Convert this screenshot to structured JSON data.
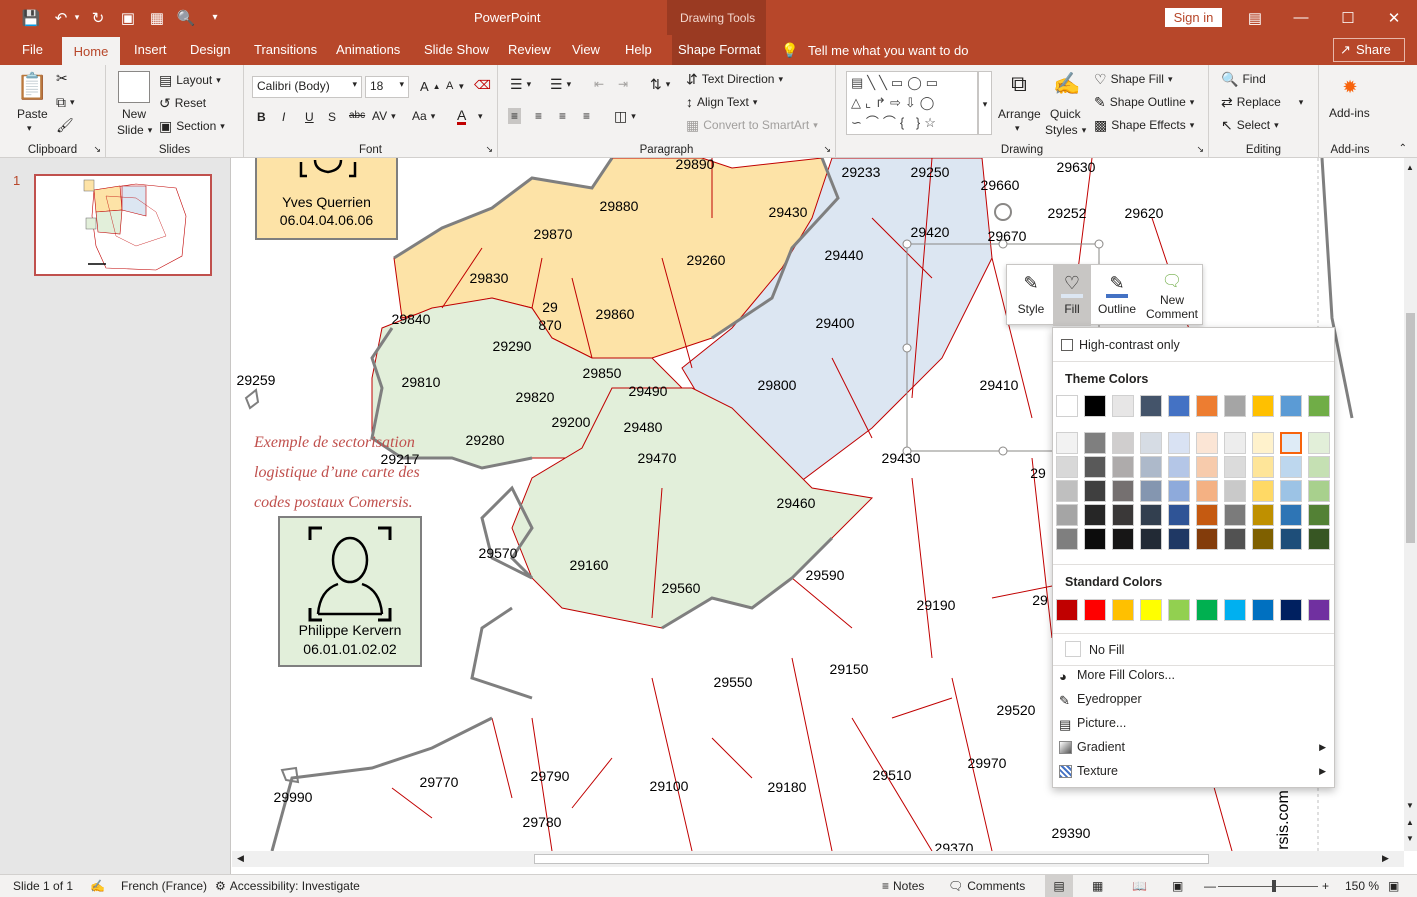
{
  "app": {
    "title": "PowerPoint",
    "context_title": "Drawing Tools",
    "sign_in": "Sign in",
    "share": "Share"
  },
  "tabs": [
    "File",
    "Home",
    "Insert",
    "Design",
    "Transitions",
    "Animations",
    "Slide Show",
    "Review",
    "View",
    "Help",
    "Shape Format"
  ],
  "tell_me": "Tell me what you want to do",
  "ribbon": {
    "clipboard": {
      "label": "Clipboard",
      "paste": "Paste"
    },
    "slides": {
      "label": "Slides",
      "new_slide_1": "New",
      "new_slide_2": "Slide",
      "layout": "Layout",
      "reset": "Reset",
      "section": "Section"
    },
    "font": {
      "label": "Font",
      "font_name": "Calibri (Body)",
      "font_size": "18",
      "bold": "B",
      "italic": "I",
      "underline": "U",
      "shadow": "S",
      "strike": "abc",
      "spacing": "AV",
      "case": "Aa",
      "color": "A",
      "grow": "A",
      "shrink": "A"
    },
    "paragraph": {
      "label": "Paragraph",
      "text_direction": "Text Direction",
      "align_text": "Align Text",
      "convert_smartart": "Convert to SmartArt"
    },
    "drawing": {
      "label": "Drawing",
      "arrange": "Arrange",
      "quick_styles_1": "Quick",
      "quick_styles_2": "Styles",
      "shape_fill": "Shape Fill",
      "shape_outline": "Shape Outline",
      "shape_effects": "Shape Effects"
    },
    "editing": {
      "label": "Editing",
      "find": "Find",
      "replace": "Replace",
      "select": "Select"
    },
    "addins": {
      "label": "Add-ins",
      "addins": "Add-ins"
    }
  },
  "slide_panel": {
    "number": "1",
    "caption_lines": [
      "Exemple de sectorisation",
      "logistique d’une carte des",
      "codes postaux Comersis."
    ]
  },
  "contacts": [
    {
      "name": "Yves Querrien",
      "phone": "06.04.04.06.06",
      "color": "#fde3a7"
    },
    {
      "name": "Philippe Kervern",
      "phone": "06.01.01.02.02",
      "color": "#e2efda"
    }
  ],
  "map_labels": [
    "29890",
    "29233",
    "29250",
    "29630",
    "29880",
    "29430",
    "29660",
    "29252",
    "29620",
    "29870",
    "29420",
    "29670",
    "29830",
    "29260",
    "29440",
    "29860",
    "29840",
    "29",
    "870",
    "29400",
    "29290",
    "29410",
    "29810",
    "29800",
    "29259",
    "29850",
    "29490",
    "29820",
    "29200",
    "29480",
    "29217",
    "29280",
    "29470",
    "29430",
    "29460",
    "29570",
    "29160",
    "29590",
    "29190",
    "29560",
    "29150",
    "29550",
    "29520",
    "29970",
    "29770",
    "29790",
    "29100",
    "29180",
    "29510",
    "29780",
    "29390",
    "29990",
    "29370",
    "29",
    "29",
    "rsis.com"
  ],
  "mini_toolbar": {
    "style": "Style",
    "fill": "Fill",
    "outline": "Outline",
    "new_comment_1": "New",
    "new_comment_2": "Comment"
  },
  "fill_menu": {
    "high_contrast": "High-contrast only",
    "theme_header": "Theme Colors",
    "standard_header": "Standard Colors",
    "no_fill": "No Fill",
    "more_colors": "More Fill Colors...",
    "eyedropper": "Eyedropper",
    "picture": "Picture...",
    "gradient": "Gradient",
    "texture": "Texture",
    "theme_top": [
      "#ffffff",
      "#000000",
      "#e7e6e6",
      "#44546a",
      "#4472c4",
      "#ed7d31",
      "#a5a5a5",
      "#ffc000",
      "#5b9bd5",
      "#70ad47"
    ],
    "theme_shades": [
      [
        "#f2f2f2",
        "#7f7f7f",
        "#d0cece",
        "#d6dce4",
        "#d9e2f3",
        "#fbe5d5",
        "#ededed",
        "#fff2cc",
        "#deebf6",
        "#e2efd9"
      ],
      [
        "#d8d8d8",
        "#595959",
        "#aeabab",
        "#adb9ca",
        "#b4c6e7",
        "#f7cbac",
        "#dbdbdb",
        "#fee599",
        "#bdd7ee",
        "#c5e0b3"
      ],
      [
        "#bfbfbf",
        "#3f3f3f",
        "#757070",
        "#8496b0",
        "#8eaadb",
        "#f4b183",
        "#c9c9c9",
        "#ffd965",
        "#9cc3e5",
        "#a8d08d"
      ],
      [
        "#a5a5a5",
        "#262626",
        "#3a3838",
        "#323f4f",
        "#2f5496",
        "#c55a11",
        "#7b7b7b",
        "#bf9000",
        "#2e75b5",
        "#538135"
      ],
      [
        "#7f7f7f",
        "#0c0c0c",
        "#171616",
        "#222a35",
        "#1f3864",
        "#833c0b",
        "#525252",
        "#7f6000",
        "#1e4e79",
        "#375623"
      ]
    ],
    "standard": [
      "#c00000",
      "#ff0000",
      "#ffc000",
      "#ffff00",
      "#92d050",
      "#00b050",
      "#00b0f0",
      "#0070c0",
      "#002060",
      "#7030a0"
    ]
  },
  "status": {
    "slide": "Slide 1 of 1",
    "language": "French (France)",
    "accessibility": "Accessibility: Investigate",
    "notes": "Notes",
    "comments": "Comments",
    "zoom": "150 %"
  }
}
